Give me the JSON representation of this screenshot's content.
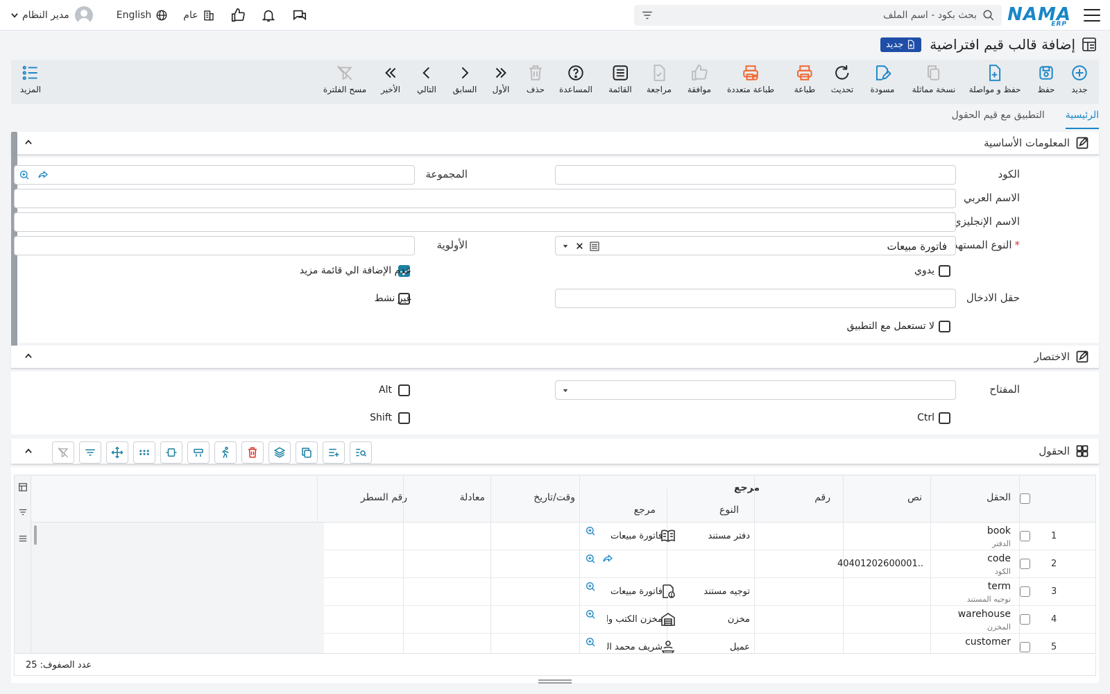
{
  "topbar": {
    "logo": "NAMA",
    "logo_sub": "ERP",
    "search_placeholder": "بحث بكود - اسم الملف",
    "user_name": "مدير النظام",
    "language": "English",
    "scope": "عام"
  },
  "page": {
    "title": "إضافة قالب قيم افتراضية",
    "badge": "جديد"
  },
  "toolbar": [
    {
      "key": "new",
      "label": "جديد",
      "icon": "plus-circle-icon",
      "color": "#1a86c8"
    },
    {
      "key": "save",
      "label": "حفظ",
      "icon": "save-icon",
      "color": "#1a86c8"
    },
    {
      "key": "save-continue",
      "label": "حفظ و مواصلة",
      "icon": "file-plus-icon",
      "color": "#1a86c8"
    },
    {
      "key": "copy",
      "label": "نسخة مماثلة",
      "icon": "copy-icon",
      "color": "#bbb"
    },
    {
      "key": "draft",
      "label": "مسودة",
      "icon": "draft-edit-icon",
      "color": "#1a86c8"
    },
    {
      "key": "refresh",
      "label": "تحديث",
      "icon": "refresh-icon",
      "color": "#222"
    },
    {
      "key": "print",
      "label": "طباعة",
      "icon": "printer-icon",
      "color": "#f0662d"
    },
    {
      "key": "multi-print",
      "label": "طباعة متعددة",
      "icon": "multi-printer-icon",
      "color": "#f0662d"
    },
    {
      "key": "approve",
      "label": "موافقة",
      "icon": "thumbs-up-icon",
      "color": "#bbb"
    },
    {
      "key": "review",
      "label": "مراجعة",
      "icon": "file-check-icon",
      "color": "#bbb"
    },
    {
      "key": "list",
      "label": "القائمة",
      "icon": "list-icon",
      "color": "#222"
    },
    {
      "key": "help",
      "label": "المساعدة",
      "icon": "help-icon",
      "color": "#222"
    },
    {
      "key": "delete",
      "label": "حذف",
      "icon": "trash-icon",
      "color": "#bbb"
    },
    {
      "key": "first",
      "label": "الأول",
      "icon": "double-chevron-right-icon",
      "color": "#222"
    },
    {
      "key": "prev",
      "label": "السابق",
      "icon": "chevron-right-icon",
      "color": "#222"
    },
    {
      "key": "next",
      "label": "التالي",
      "icon": "chevron-left-icon",
      "color": "#222"
    },
    {
      "key": "last",
      "label": "الأخير",
      "icon": "double-chevron-left-icon",
      "color": "#222"
    },
    {
      "key": "clear-filter",
      "label": "مسح الفلترة",
      "icon": "filter-off-icon",
      "color": "#bbb"
    },
    {
      "key": "more",
      "label": "المزيد",
      "icon": "more-list-icon",
      "color": "#1a86c8"
    }
  ],
  "tabs": [
    "الرئيسية",
    "التطبيق مع قيم الحقول"
  ],
  "basic_info": {
    "title": "المعلومات الأساسية",
    "code_label": "الكود",
    "group_label": "المجموعة",
    "arabic_name_label": "الاسم العربي",
    "english_name_label": "الاسم الإنجليزي",
    "target_type_label": "النوع المستهدف",
    "target_type_value": "فاتورة مبيعات",
    "priority_label": "الأولوية",
    "manual_label": "يدوي",
    "no_add_more_label": "عدم الإضافة الي قائمة مزيد",
    "no_add_more_checked": true,
    "input_field_label": "حقل الادخال",
    "inactive_label": "غير نشط",
    "not_used_label": "لا تستعمل مع التطبيق"
  },
  "shortcut": {
    "title": "الاختصار",
    "key_label": "المفتاح",
    "alt_label": "Alt",
    "ctrl_label": "Ctrl",
    "shift_label": "Shift"
  },
  "fields_section": {
    "title": "الحقول"
  },
  "grid": {
    "headers": {
      "field": "الحقل",
      "text": "نص",
      "number": "رقم",
      "reference": "مرجع",
      "ref_type": "النوع",
      "ref_ref": "مرجع",
      "datetime": "وقت/تاريخ",
      "equation": "معادلة",
      "line_number": "رقم السطر"
    },
    "rows": [
      {
        "num": "1",
        "field": "book",
        "field_sub": "الدفتر",
        "text": "",
        "ref_type": "دفتر مستند",
        "ref_icon": "book-icon",
        "ref_value": "فاتورة مبيعات",
        "share": false
      },
      {
        "num": "2",
        "field": "code",
        "field_sub": "الكود",
        "text": "40401202600001...",
        "ref_type": "",
        "ref_icon": "",
        "ref_value": "",
        "share": true
      },
      {
        "num": "3",
        "field": "term",
        "field_sub": "توجيه المستند",
        "text": "",
        "ref_type": "توجيه مستند",
        "ref_icon": "doc-settings-icon",
        "ref_value": "فاتورة مبيعات",
        "share": false
      },
      {
        "num": "4",
        "field": "warehouse",
        "field_sub": "المخزن",
        "text": "",
        "ref_type": "مخزن",
        "ref_icon": "warehouse-icon",
        "ref_value": "مخزن الكتب والـ",
        "share": false
      },
      {
        "num": "5",
        "field": "customer",
        "field_sub": "",
        "text": "",
        "ref_type": "عميل",
        "ref_icon": "customer-icon",
        "ref_value": "شريف محمد الد",
        "share": false
      }
    ],
    "row_count": "عدد الصفوف: 25"
  }
}
